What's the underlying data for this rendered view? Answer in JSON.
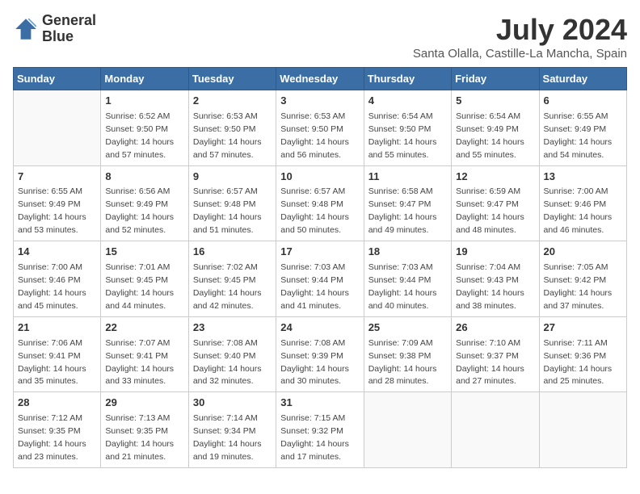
{
  "header": {
    "logo_line1": "General",
    "logo_line2": "Blue",
    "month": "July 2024",
    "location": "Santa Olalla, Castille-La Mancha, Spain"
  },
  "weekdays": [
    "Sunday",
    "Monday",
    "Tuesday",
    "Wednesday",
    "Thursday",
    "Friday",
    "Saturday"
  ],
  "weeks": [
    [
      {
        "day": "",
        "info": ""
      },
      {
        "day": "1",
        "info": "Sunrise: 6:52 AM\nSunset: 9:50 PM\nDaylight: 14 hours\nand 57 minutes."
      },
      {
        "day": "2",
        "info": "Sunrise: 6:53 AM\nSunset: 9:50 PM\nDaylight: 14 hours\nand 57 minutes."
      },
      {
        "day": "3",
        "info": "Sunrise: 6:53 AM\nSunset: 9:50 PM\nDaylight: 14 hours\nand 56 minutes."
      },
      {
        "day": "4",
        "info": "Sunrise: 6:54 AM\nSunset: 9:50 PM\nDaylight: 14 hours\nand 55 minutes."
      },
      {
        "day": "5",
        "info": "Sunrise: 6:54 AM\nSunset: 9:49 PM\nDaylight: 14 hours\nand 55 minutes."
      },
      {
        "day": "6",
        "info": "Sunrise: 6:55 AM\nSunset: 9:49 PM\nDaylight: 14 hours\nand 54 minutes."
      }
    ],
    [
      {
        "day": "7",
        "info": "Sunrise: 6:55 AM\nSunset: 9:49 PM\nDaylight: 14 hours\nand 53 minutes."
      },
      {
        "day": "8",
        "info": "Sunrise: 6:56 AM\nSunset: 9:49 PM\nDaylight: 14 hours\nand 52 minutes."
      },
      {
        "day": "9",
        "info": "Sunrise: 6:57 AM\nSunset: 9:48 PM\nDaylight: 14 hours\nand 51 minutes."
      },
      {
        "day": "10",
        "info": "Sunrise: 6:57 AM\nSunset: 9:48 PM\nDaylight: 14 hours\nand 50 minutes."
      },
      {
        "day": "11",
        "info": "Sunrise: 6:58 AM\nSunset: 9:47 PM\nDaylight: 14 hours\nand 49 minutes."
      },
      {
        "day": "12",
        "info": "Sunrise: 6:59 AM\nSunset: 9:47 PM\nDaylight: 14 hours\nand 48 minutes."
      },
      {
        "day": "13",
        "info": "Sunrise: 7:00 AM\nSunset: 9:46 PM\nDaylight: 14 hours\nand 46 minutes."
      }
    ],
    [
      {
        "day": "14",
        "info": "Sunrise: 7:00 AM\nSunset: 9:46 PM\nDaylight: 14 hours\nand 45 minutes."
      },
      {
        "day": "15",
        "info": "Sunrise: 7:01 AM\nSunset: 9:45 PM\nDaylight: 14 hours\nand 44 minutes."
      },
      {
        "day": "16",
        "info": "Sunrise: 7:02 AM\nSunset: 9:45 PM\nDaylight: 14 hours\nand 42 minutes."
      },
      {
        "day": "17",
        "info": "Sunrise: 7:03 AM\nSunset: 9:44 PM\nDaylight: 14 hours\nand 41 minutes."
      },
      {
        "day": "18",
        "info": "Sunrise: 7:03 AM\nSunset: 9:44 PM\nDaylight: 14 hours\nand 40 minutes."
      },
      {
        "day": "19",
        "info": "Sunrise: 7:04 AM\nSunset: 9:43 PM\nDaylight: 14 hours\nand 38 minutes."
      },
      {
        "day": "20",
        "info": "Sunrise: 7:05 AM\nSunset: 9:42 PM\nDaylight: 14 hours\nand 37 minutes."
      }
    ],
    [
      {
        "day": "21",
        "info": "Sunrise: 7:06 AM\nSunset: 9:41 PM\nDaylight: 14 hours\nand 35 minutes."
      },
      {
        "day": "22",
        "info": "Sunrise: 7:07 AM\nSunset: 9:41 PM\nDaylight: 14 hours\nand 33 minutes."
      },
      {
        "day": "23",
        "info": "Sunrise: 7:08 AM\nSunset: 9:40 PM\nDaylight: 14 hours\nand 32 minutes."
      },
      {
        "day": "24",
        "info": "Sunrise: 7:08 AM\nSunset: 9:39 PM\nDaylight: 14 hours\nand 30 minutes."
      },
      {
        "day": "25",
        "info": "Sunrise: 7:09 AM\nSunset: 9:38 PM\nDaylight: 14 hours\nand 28 minutes."
      },
      {
        "day": "26",
        "info": "Sunrise: 7:10 AM\nSunset: 9:37 PM\nDaylight: 14 hours\nand 27 minutes."
      },
      {
        "day": "27",
        "info": "Sunrise: 7:11 AM\nSunset: 9:36 PM\nDaylight: 14 hours\nand 25 minutes."
      }
    ],
    [
      {
        "day": "28",
        "info": "Sunrise: 7:12 AM\nSunset: 9:35 PM\nDaylight: 14 hours\nand 23 minutes."
      },
      {
        "day": "29",
        "info": "Sunrise: 7:13 AM\nSunset: 9:35 PM\nDaylight: 14 hours\nand 21 minutes."
      },
      {
        "day": "30",
        "info": "Sunrise: 7:14 AM\nSunset: 9:34 PM\nDaylight: 14 hours\nand 19 minutes."
      },
      {
        "day": "31",
        "info": "Sunrise: 7:15 AM\nSunset: 9:32 PM\nDaylight: 14 hours\nand 17 minutes."
      },
      {
        "day": "",
        "info": ""
      },
      {
        "day": "",
        "info": ""
      },
      {
        "day": "",
        "info": ""
      }
    ]
  ]
}
